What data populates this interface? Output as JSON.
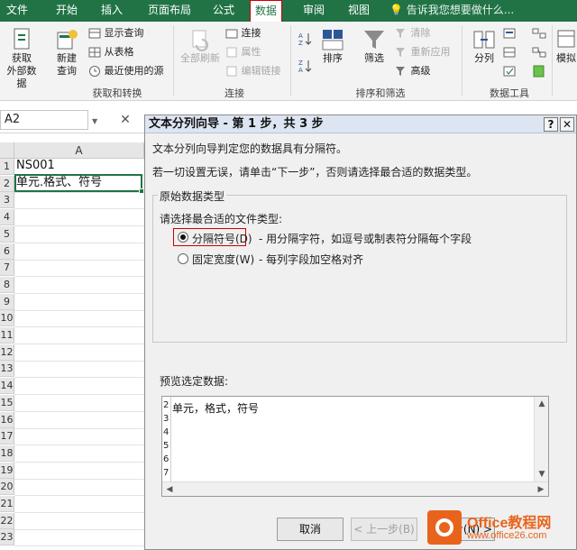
{
  "ribbon_tabs": [
    "文件",
    "开始",
    "插入",
    "页面布局",
    "公式",
    "数据",
    "审阅",
    "视图"
  ],
  "active_tab": "数据",
  "tell_me": "告诉我您想要做什么...",
  "get_transform": {
    "get_external": [
      "获取",
      "外部数据"
    ],
    "new_query": [
      "新建",
      "查询"
    ],
    "show_queries": "显示查询",
    "from_table": "从表格",
    "recent_sources": "最近使用的源",
    "label": "获取和转换"
  },
  "connections": {
    "refresh_all": "全部刷新",
    "connections": "连接",
    "properties": "属性",
    "edit_links": "编辑链接",
    "label": "连接"
  },
  "sort_filter": {
    "sort": "排序",
    "filter": "筛选",
    "clear": "清除",
    "reapply": "重新应用",
    "advanced": "高级",
    "label": "排序和筛选"
  },
  "data_tools": {
    "text_to_columns": "分列",
    "label": "数据工具"
  },
  "forecast": {
    "whatif": "模拟"
  },
  "name_box": "A2",
  "formula_cancel": "✕",
  "sheet": {
    "column_header": "A",
    "rows": [
      "1",
      "2",
      "3",
      "4",
      "5",
      "6",
      "7",
      "8",
      "9",
      "10",
      "11",
      "12",
      "13",
      "14",
      "15",
      "16",
      "17",
      "18",
      "19",
      "20",
      "21",
      "22",
      "23"
    ],
    "a1": "NS001",
    "a2": "单元.格式、符号"
  },
  "dialog": {
    "title": "文本分列向导 - 第 1 步，共 3 步",
    "help": "?",
    "close": "✕",
    "intro": "文本分列向导判定您的数据具有分隔符。",
    "instruction": "若一切设置无误，请单击“下一步”，否则请选择最合适的数据类型。",
    "group_title": "原始数据类型",
    "choose_label": "请选择最合适的文件类型:",
    "option_delimited": "分隔符号(D)",
    "option_delimited_desc": "- 用分隔字符，如逗号或制表符分隔每个字段",
    "option_fixed": "固定宽度(W)",
    "option_fixed_desc": "- 每列字段加空格对齐",
    "preview_label": "预览选定数据:",
    "preview_rows": [
      "2",
      "3",
      "4",
      "5",
      "6",
      "7"
    ],
    "preview_text": "单元，格式，符号",
    "cancel": "取消",
    "back": "< 上一步(B)",
    "next": "下一步(N) >"
  },
  "watermark": {
    "line1": "Office教程网",
    "line2": "www.office26.com"
  }
}
